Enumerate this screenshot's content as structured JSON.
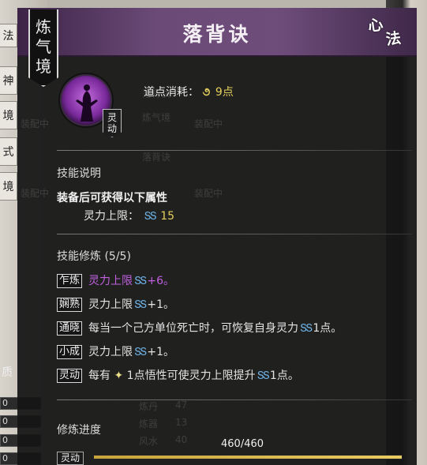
{
  "background": {
    "left_tabs": [
      "神",
      "境",
      "式",
      "境"
    ],
    "left_top_glyph": "法",
    "left_quality_glyph": "质",
    "left_stats": [
      "0",
      "0",
      "0",
      "0"
    ],
    "bottom_left_tag": "灵动",
    "ghost_equip": [
      "装配中",
      "装配中",
      "装配中",
      "装配中"
    ],
    "ghost_names": [
      "落背诀",
      "炼气境",
      "落背诀"
    ],
    "ghost_stats": [
      "炼丹",
      "炼器",
      "风水"
    ],
    "ghost_values": [
      "47",
      "13",
      "40"
    ]
  },
  "panel": {
    "title": "落背诀",
    "seal_chars": [
      "心",
      "法"
    ],
    "realm": "炼气境",
    "icon_badge": "灵动",
    "cost_label": "道点消耗：",
    "cost_value": "9点",
    "skill_desc": {
      "title": "技能说明",
      "main": "装备后可获得以下属性",
      "attr_label": "灵力上限：",
      "attr_value": "15"
    },
    "training": {
      "title": "技能修炼 (5/5)",
      "rows": [
        {
          "tag": "乍炼",
          "text": "灵力上限",
          "value": "+6。",
          "highlight": true
        },
        {
          "tag": "娴熟",
          "text": "灵力上限",
          "value": "+1。",
          "highlight": false
        },
        {
          "tag": "通晓",
          "text": "每当一个己方单位死亡时，可恢复自身灵力",
          "value": "1点。",
          "highlight": false
        },
        {
          "tag": "小成",
          "text": "灵力上限",
          "value": "+1。",
          "highlight": false
        },
        {
          "tag": "灵动",
          "text_before": "每有",
          "text_mid": "1点悟性可使灵力上限提升",
          "value": "1点。",
          "highlight": false
        }
      ]
    },
    "progress": {
      "label": "修炼进度",
      "text": "460/460",
      "current": 460,
      "max": 460
    }
  },
  "colors": {
    "header_purple": "#6b4a77",
    "gold": "#e4cf5c",
    "spirit_blue": "#6fb4e8",
    "highlight_purple": "#c05fdf"
  }
}
